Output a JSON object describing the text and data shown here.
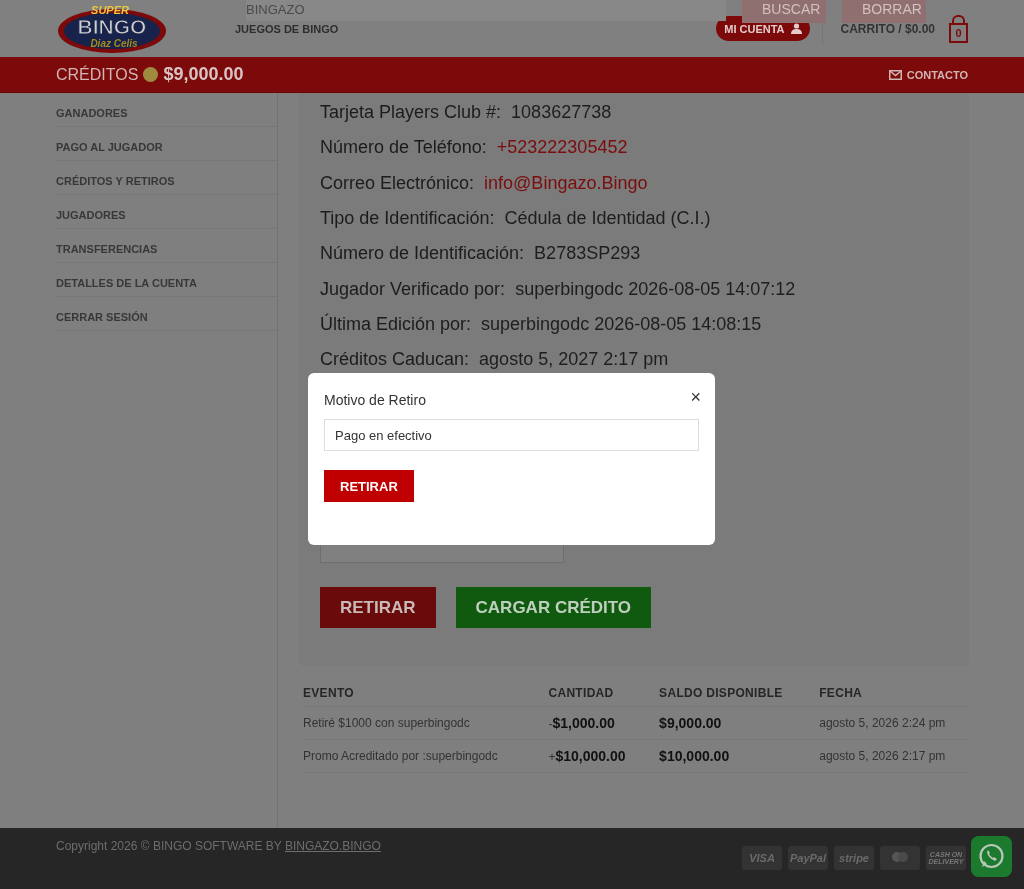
{
  "header": {
    "search_value": "BINGAZO",
    "search_buttons": [
      "BUSCAR",
      "BORRAR"
    ],
    "logo": {
      "top": "SUPER",
      "main": "BINGO",
      "sub": "Diaz Celis"
    },
    "nav": [
      "JUEGOS DE BINGO"
    ],
    "account_button": "MI CUENTA",
    "cart": {
      "label": "CARRITO / $0.00",
      "count": "0"
    }
  },
  "credits_bar": {
    "label": "CRÉDITOS",
    "amount": "$9,000.00",
    "contact": "CONTACTO"
  },
  "sidebar": {
    "items": [
      {
        "label": "GANADORES",
        "selected": false
      },
      {
        "label": "PAGO AL JUGADOR",
        "selected": false
      },
      {
        "label": "CRÉDITOS Y RETIROS",
        "selected": false
      },
      {
        "label": "JUGADORES",
        "selected": false
      },
      {
        "label": "TRANSFERENCIAS",
        "selected": false
      },
      {
        "label": "DETALLES DE LA CUENTA",
        "selected": false
      },
      {
        "label": "CERRAR SESIÓN",
        "selected": false
      }
    ]
  },
  "details": [
    {
      "label": "Tarjeta Players Club #:",
      "value": "1083627738",
      "kind": "plain"
    },
    {
      "label": "Número de Teléfono:",
      "value": "+523222305452",
      "kind": "link"
    },
    {
      "label": "Correo Electrónico:",
      "value": "info@Bingazo.Bingo",
      "kind": "link"
    },
    {
      "label": "Tipo de Identificación:",
      "value": "Cédula de Identidad (C.I.)",
      "kind": "plain"
    },
    {
      "label": "Número de Identificación:",
      "value": "B2783SP293",
      "kind": "plain"
    },
    {
      "label": "Jugador Verificado por:",
      "value": "superbingodc 2026-08-05 14:07:12",
      "kind": "plain"
    },
    {
      "label": "Última Edición por:",
      "value": "superbingodc 2026-08-05 14:08:15",
      "kind": "plain"
    },
    {
      "label": "Créditos Caducan:",
      "value": "agosto 5, 2027 2:17 pm",
      "kind": "plain"
    }
  ],
  "actions": [
    {
      "label": "RETIRAR",
      "kind": "danger"
    },
    {
      "label": "CARGAR CRÉDITO",
      "kind": "success"
    }
  ],
  "history": {
    "columns": [
      "EVENTO",
      "CANTIDAD",
      "SALDO DISPONIBLE",
      "FECHA"
    ],
    "rows": [
      {
        "event": "Retiré $1000 con superbingodc",
        "sign": "-",
        "amount": "$1,000.00",
        "balance": "$9,000.00",
        "date": "agosto 5, 2026 2:24 pm"
      },
      {
        "event": "Promo Acreditado por :superbingodc",
        "sign": "+",
        "amount": "$10,000.00",
        "balance": "$10,000.00",
        "date": "agosto 5, 2026 2:17 pm"
      }
    ]
  },
  "footer": {
    "copyright": "Copyright 2026 © BINGO SOFTWARE BY",
    "link": "BINGAZO.BINGO",
    "payments": [
      {
        "kind": "text",
        "label": "VISA"
      },
      {
        "kind": "text",
        "label": "PayPal"
      },
      {
        "kind": "text",
        "label": "stripe"
      },
      {
        "kind": "mastercard"
      },
      {
        "kind": "small",
        "label": "CASH ON DELIVERY"
      }
    ]
  },
  "modal": {
    "title": "Motivo de Retiro",
    "close": "×",
    "value": "Pago en efectivo",
    "button": "RETIRAR"
  }
}
